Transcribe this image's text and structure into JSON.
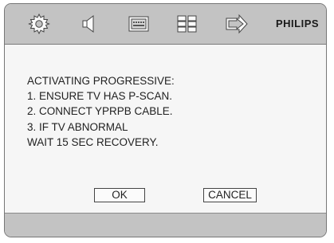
{
  "toolbar": {
    "icons": [
      "gear-icon",
      "speaker-icon",
      "display-icon",
      "grid-icon",
      "arrow-right-icon"
    ],
    "brand": "PHILIPS"
  },
  "dialog": {
    "lines": [
      "ACTIVATING PROGRESSIVE:",
      "1. ENSURE TV HAS P-SCAN.",
      "2. CONNECT YPRPB CABLE.",
      "3. IF TV ABNORMAL",
      "WAIT 15 SEC RECOVERY."
    ],
    "ok_label": "OK",
    "cancel_label": "CANCEL"
  },
  "colors": {
    "bar": "#c3c3c3",
    "panel": "#f6f6f6",
    "text": "#222222"
  }
}
